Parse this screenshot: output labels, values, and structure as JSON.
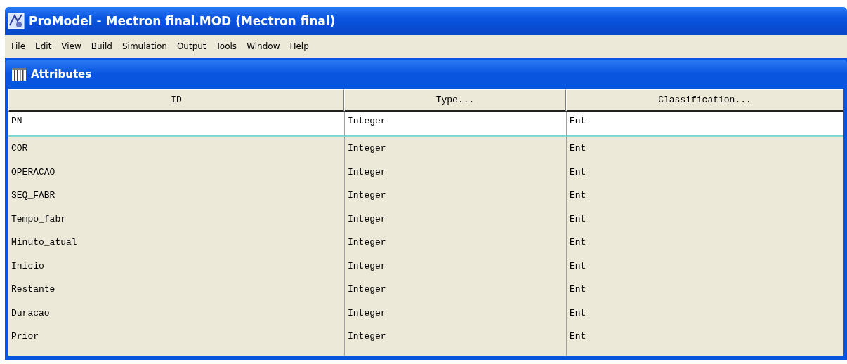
{
  "window": {
    "title": "ProModel - Mectron final.MOD (Mectron final)"
  },
  "menu": [
    "File",
    "Edit",
    "View",
    "Build",
    "Simulation",
    "Output",
    "Tools",
    "Window",
    "Help"
  ],
  "panel": {
    "title": "Attributes"
  },
  "table": {
    "columns": [
      "ID",
      "Type...",
      "Classification..."
    ],
    "rows": [
      {
        "cells": [
          "PN",
          "Integer",
          "Ent"
        ],
        "selected": true
      },
      {
        "cells": [
          "COR",
          "Integer",
          "Ent"
        ],
        "selected": false
      },
      {
        "cells": [
          "OPERACAO",
          "Integer",
          "Ent"
        ],
        "selected": false
      },
      {
        "cells": [
          "SEQ_FABR",
          "Integer",
          "Ent"
        ],
        "selected": false
      },
      {
        "cells": [
          "Tempo_fabr",
          "Integer",
          "Ent"
        ],
        "selected": false
      },
      {
        "cells": [
          "Minuto_atual",
          "Integer",
          "Ent"
        ],
        "selected": false
      },
      {
        "cells": [
          "Inicio",
          "Integer",
          "Ent"
        ],
        "selected": false
      },
      {
        "cells": [
          "Restante",
          "Integer",
          "Ent"
        ],
        "selected": false
      },
      {
        "cells": [
          "Duracao",
          "Integer",
          "Ent"
        ],
        "selected": false
      },
      {
        "cells": [
          "Prior",
          "Integer",
          "Ent"
        ],
        "selected": false
      }
    ]
  }
}
